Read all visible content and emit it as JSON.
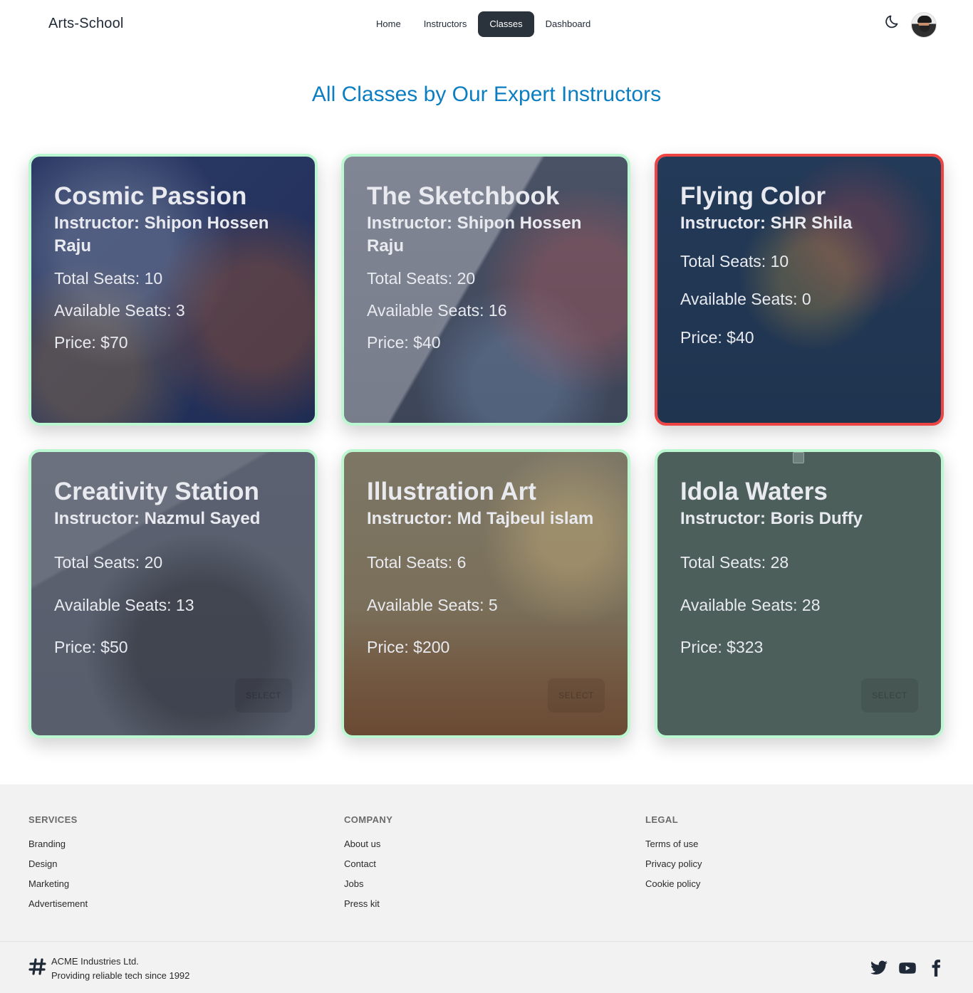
{
  "brand": "Arts-School",
  "nav": {
    "items": [
      {
        "label": "Home"
      },
      {
        "label": "Instructors"
      },
      {
        "label": "Classes"
      },
      {
        "label": "Dashboard"
      }
    ],
    "active": "Classes"
  },
  "icons": {
    "theme_toggle": "moon-icon",
    "avatar": "user-avatar",
    "company_logo": "hash-logo-icon",
    "social": [
      "twitter-icon",
      "youtube-icon",
      "facebook-icon"
    ]
  },
  "page_title": "All Classes by Our Expert Instructors",
  "colors": {
    "title": "#0b7ec2",
    "card_border": "#bbf7d0",
    "card_border_soldout": "#ef4444",
    "nav_active_bg": "#2a323c"
  },
  "classes": [
    {
      "title": "Cosmic Passion",
      "instructor": "Instructor: Shipon Hossen Raju",
      "total_seats": "Total Seats: 10",
      "available_seats": "Available Seats: 3",
      "price": "Price: $70",
      "sold_out": false
    },
    {
      "title": "The Sketchbook",
      "instructor": "Instructor: Shipon Hossen Raju",
      "total_seats": "Total Seats: 20",
      "available_seats": "Available Seats: 16",
      "price": "Price: $40",
      "sold_out": false
    },
    {
      "title": "Flying Color",
      "instructor": "Instructor: SHR Shila",
      "total_seats": "Total Seats: 10",
      "available_seats": "Available Seats: 0",
      "price": "Price: $40",
      "sold_out": true
    },
    {
      "title": "Creativity Station",
      "instructor": "Instructor: Nazmul Sayed",
      "total_seats": "Total Seats: 20",
      "available_seats": "Available Seats: 13",
      "price": "Price: $50",
      "sold_out": false,
      "button": "SELECT"
    },
    {
      "title": "Illustration Art",
      "instructor": "Instructor: Md Tajbeul islam",
      "total_seats": "Total Seats: 6",
      "available_seats": "Available Seats: 5",
      "price": "Price: $200",
      "sold_out": false,
      "button": "SELECT"
    },
    {
      "title": "Idola Waters",
      "instructor": "Instructor: Boris Duffy",
      "total_seats": "Total Seats: 28",
      "available_seats": "Available Seats: 28",
      "price": "Price: $323",
      "sold_out": false,
      "button": "SELECT"
    }
  ],
  "footer": {
    "services": {
      "heading": "SERVICES",
      "links": [
        "Branding",
        "Design",
        "Marketing",
        "Advertisement"
      ]
    },
    "company": {
      "heading": "COMPANY",
      "links": [
        "About us",
        "Contact",
        "Jobs",
        "Press kit"
      ]
    },
    "legal": {
      "heading": "LEGAL",
      "links": [
        "Terms of use",
        "Privacy policy",
        "Cookie policy"
      ]
    },
    "company_name": "ACME Industries Ltd.",
    "tagline": "Providing reliable tech since 1992"
  }
}
